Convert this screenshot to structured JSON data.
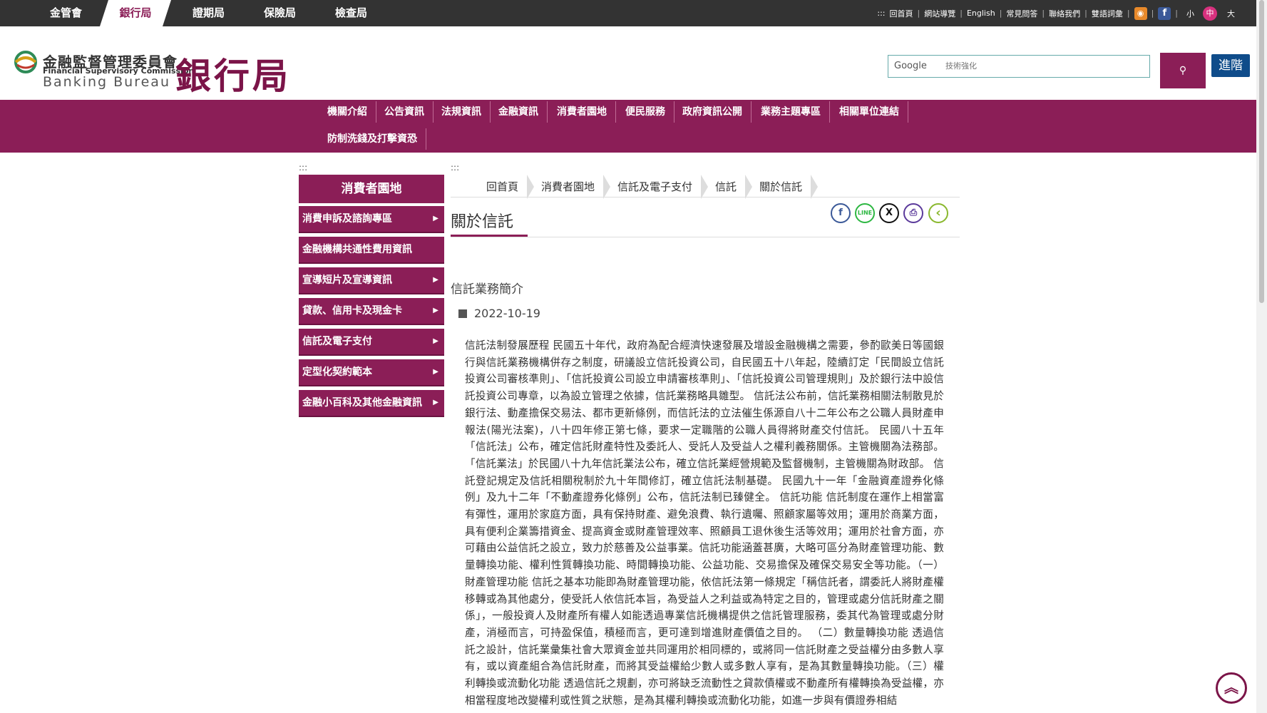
{
  "top_tabs": [
    "金管會",
    "銀行局",
    "證期局",
    "保險局",
    "檢查局"
  ],
  "top_links": [
    "回首頁",
    "網站導覽",
    "English",
    "常見問答",
    "聯絡我們",
    "雙語詞彙"
  ],
  "top_links_lead": ":::",
  "font_sizes": {
    "small": "小",
    "medium": "中",
    "large": "大"
  },
  "logo": {
    "cn": "金融監督管理委員會",
    "en1": "Financial Supervisory Commission",
    "en2": "Banking Bureau",
    "big": "銀行局"
  },
  "search": {
    "g_label": "Google",
    "placeholder": "技術強化",
    "button_icon": "search-icon",
    "advanced": "進階"
  },
  "nav": [
    "機關介紹",
    "公告資訊",
    "法規資訊",
    "金融資訊",
    "消費者園地",
    "便民服務",
    "政府資訊公開",
    "業務主題專區",
    "相關單位連結",
    "防制洗錢及打擊資恐"
  ],
  "accesskey": ":::",
  "sidebar": {
    "title": "消費者園地",
    "items": [
      {
        "label": "消費申訴及諮詢專區",
        "arrow": true
      },
      {
        "label": "金融機構共通性費用資訊",
        "arrow": false
      },
      {
        "label": "宣導短片及宣導資訊",
        "arrow": true
      },
      {
        "label": "貸款、信用卡及現金卡",
        "arrow": true
      },
      {
        "label": "信託及電子支付",
        "arrow": true
      },
      {
        "label": "定型化契約範本",
        "arrow": true
      },
      {
        "label": "金融小百科及其他金融資訊",
        "arrow": true
      }
    ]
  },
  "breadcrumb": [
    "回首頁",
    "消費者園地",
    "信託及電子支付",
    "信託",
    "關於信託"
  ],
  "page_title": "關於信託",
  "share_icons": [
    "facebook-icon",
    "line-icon",
    "x-icon",
    "print-icon",
    "back-icon"
  ],
  "share_labels": {
    "facebook": "f",
    "line": "LINE",
    "x": "X",
    "print": "⎙",
    "back": "‹"
  },
  "article": {
    "subtitle": "信託業務簡介",
    "date": "2022-10-19",
    "body": "信託法制發展歷程 民國五十年代，政府為配合經濟快速發展及增設金融機構之需要，參酌歐美日等國銀行與信託業務機構併存之制度，研議設立信託投資公司，自民國五十八年起，陸續訂定「民間設立信託投資公司審核準則」、「信託投資公司設立申請審核準則」、「信託投資公司管理規則」及於銀行法中設信託投資公司專章，以為設立管理之依據，信託業務略具雛型。 信託法公布前，信託業務相關法制散見於銀行法、動產擔保交易法、都市更新條例，而信託法的立法催生係源自八十二年公布之公職人員財產申報法(陽光法案)，八十四年修正第七條，要求一定職階的公職人員得將財產交付信託。 民國八十五年「信託法」公布，確定信託財產特性及委託人、受託人及受益人之權利義務關係。主管機關為法務部。「信託業法」於民國八十九年信託業法公布，確立信託業經營規範及監督機制，主管機關為財政部。 信託登記規定及信託相關稅制於九十年間修訂，確立信託法制基礎。 民國九十一年「金融資產證券化條例」及九十二年「不動產證券化條例」公布，信託法制已臻健全。 信託功能 信託制度在運作上相當富有彈性，運用於家庭方面，具有保持財產、避免浪費、執行遺囑、照顧家屬等效用；運用於商業方面，具有便利企業籌措資金、提高資金或財產管理效率、照顧員工退休後生活等效用；運用於社會方面，亦可藉由公益信託之設立，致力於慈善及公益事業。信託功能涵蓋甚廣，大略可區分為財產管理功能、數量轉換功能、權利性質轉換功能、時間轉換功能、公益功能、交易擔保及確保交易安全等功能。（一）財產管理功能 信託之基本功能即為財產管理功能，依信託法第一條規定「稱信託者，謂委託人將財產權移轉或為其他處分，使受託人依信託本旨，為受益人之利益或為特定之目的，管理或處分信託財產之關係」，一般投資人及財產所有權人如能透過專業信託機構提供之信託管理服務，委其代為管理或處分財產，消極而言，可持盈保值，積極而言，更可達到增進財產價值之目的。 （二）數量轉換功能 透過信託之設計，信託業彙集社會大眾資金並共同運用於相同標的，或將同一信託財產之受益權分由多數人享有，或以資產組合為信託財產，而將其受益權給少數人或多數人享有，是為其數量轉換功能。（三）權利轉換或流動化功能 透過信託之規劃，亦可將缺乏流動性之貸款債權或不動產所有權轉換為受益權，亦相當程度地改變權利或性質之狀態，是為其權利轉換或流動化功能，如進一步與有價證券相結"
  },
  "gotop_icon": "go-top-icon",
  "colors": {
    "brand": "#8b1e57",
    "topbar": "#333333",
    "advanced_btn": "#0f4c8a"
  }
}
